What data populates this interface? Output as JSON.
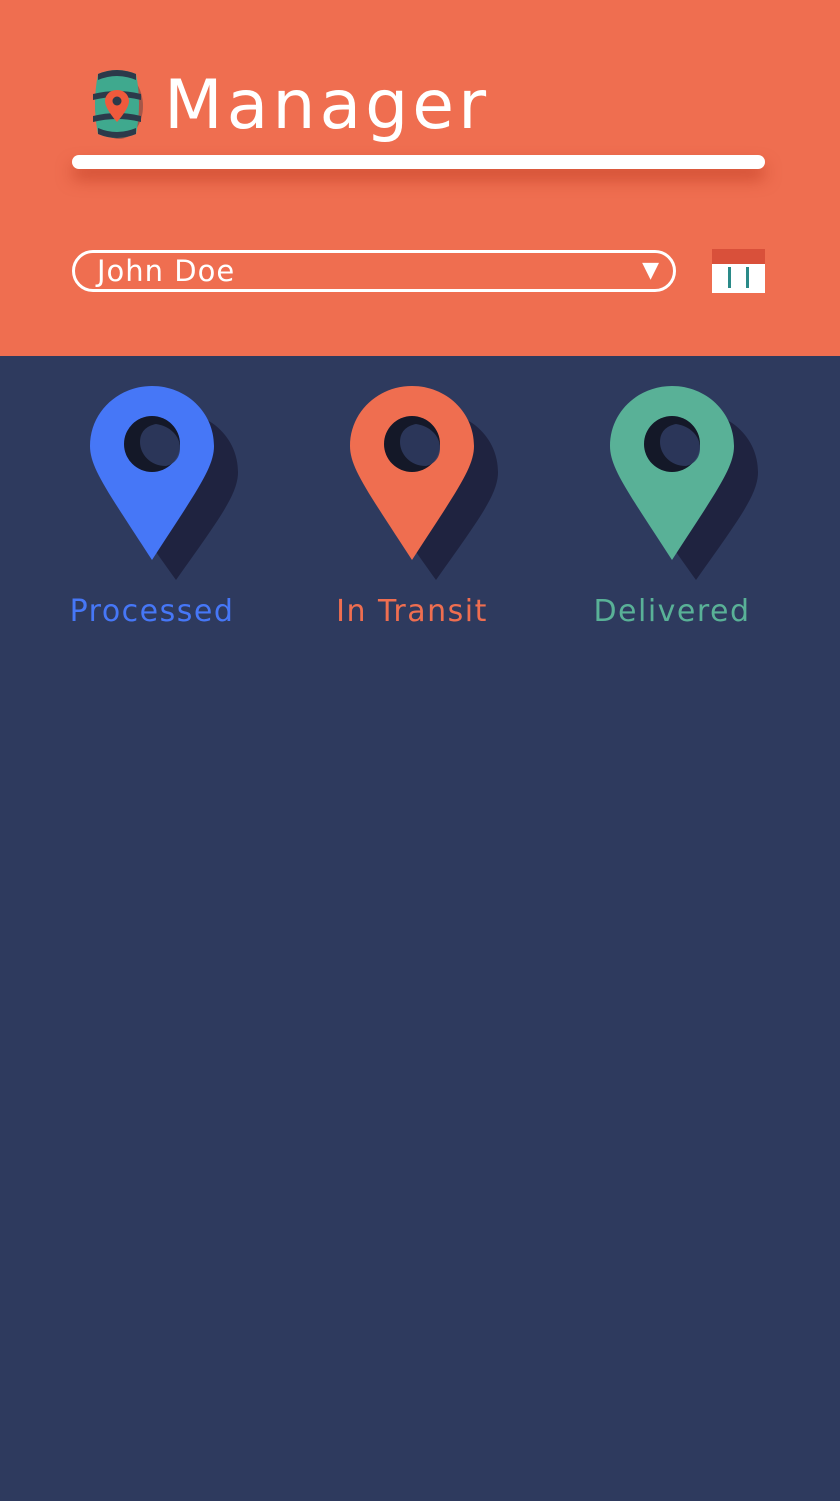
{
  "app": {
    "title": "Manager",
    "logo_icon": "barrel-location-icon"
  },
  "user_select": {
    "selected": "John Doe",
    "caret_icon": "triangle-down-icon"
  },
  "calendar": {
    "icon": "calendar-icon"
  },
  "statuses": [
    {
      "label": "Processed",
      "color": "#4677f7",
      "icon": "map-pin-icon"
    },
    {
      "label": "In Transit",
      "color": "#ef6e50",
      "icon": "map-pin-icon"
    },
    {
      "label": "Delivered",
      "color": "#59b197",
      "icon": "map-pin-icon"
    }
  ],
  "theme": {
    "header_bg": "#ef6e50",
    "body_bg": "#2e3a5e",
    "pin_shadow": "#1f2340",
    "pin_hole": "#141828"
  }
}
